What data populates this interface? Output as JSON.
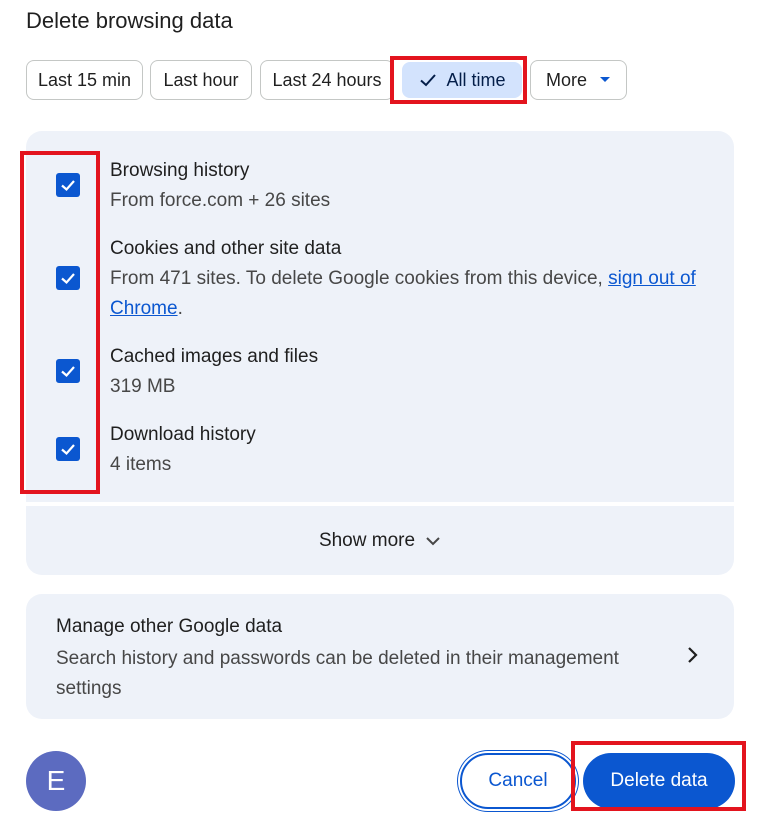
{
  "dialog": {
    "title": "Delete browsing data"
  },
  "time_ranges": [
    {
      "label": "Last 15 min",
      "selected": false
    },
    {
      "label": "Last hour",
      "selected": false
    },
    {
      "label": "Last 24 hours",
      "selected": false
    },
    {
      "label": "All time",
      "selected": true
    },
    {
      "label": "More",
      "selected": false
    }
  ],
  "items": [
    {
      "title": "Browsing history",
      "subtitle": "From force.com + 26 sites",
      "checked": true
    },
    {
      "title": "Cookies and other site data",
      "subtitle": "From 471 sites. To delete Google cookies from this device, ",
      "link": "sign out of Chrome",
      "suffix": ".",
      "checked": true
    },
    {
      "title": "Cached images and files",
      "subtitle": "319 MB",
      "checked": true
    },
    {
      "title": "Download history",
      "subtitle": "4 items",
      "checked": true
    }
  ],
  "show_more": {
    "label": "Show more"
  },
  "manage": {
    "title": "Manage other Google data",
    "description": "Search history and passwords can be deleted in their management settings"
  },
  "account": {
    "initial": "E"
  },
  "buttons": {
    "cancel": "Cancel",
    "delete": "Delete data"
  },
  "colors": {
    "accent": "#0b57d0",
    "selected_chip": "#d3e3fd",
    "panel": "#eef2f9",
    "highlight": "#e3141e",
    "avatar": "#5c6bc0"
  }
}
